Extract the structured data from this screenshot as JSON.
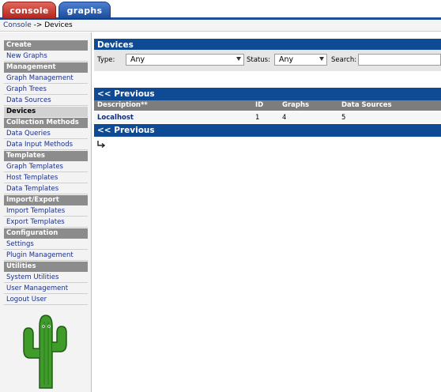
{
  "tabs": {
    "console": "console",
    "graphs": "graphs"
  },
  "breadcrumb": {
    "link": "Console",
    "sep": " -> ",
    "current": "Devices"
  },
  "sidebar": {
    "sections": [
      {
        "header": "Create",
        "items": [
          "New Graphs"
        ]
      },
      {
        "header": "Management",
        "items": [
          "Graph Management",
          "Graph Trees",
          "Data Sources",
          "Devices"
        ]
      },
      {
        "header": "Collection Methods",
        "items": [
          "Data Queries",
          "Data Input Methods"
        ]
      },
      {
        "header": "Templates",
        "items": [
          "Graph Templates",
          "Host Templates",
          "Data Templates"
        ]
      },
      {
        "header": "Import/Export",
        "items": [
          "Import Templates",
          "Export Templates"
        ]
      },
      {
        "header": "Configuration",
        "items": [
          "Settings",
          "Plugin Management"
        ]
      },
      {
        "header": "Utilities",
        "items": [
          "System Utilities",
          "User Management",
          "Logout User"
        ]
      }
    ],
    "selected": "Devices"
  },
  "main": {
    "title": "Devices",
    "filters": {
      "type_label": "Type:",
      "type_value": "Any",
      "status_label": "Status:",
      "status_value": "Any",
      "search_label": "Search:",
      "search_value": ""
    },
    "nav_previous": "<< Previous",
    "columns": [
      "Description**",
      "ID",
      "Graphs",
      "Data Sources"
    ],
    "rows": [
      {
        "description": "Localhost",
        "id": "1",
        "graphs": "4",
        "data_sources": "5"
      }
    ]
  },
  "colors": {
    "accent_blue": "#0f4a94",
    "console_red": "#c0392b",
    "menu_header_gray": "#8c8c8c"
  }
}
